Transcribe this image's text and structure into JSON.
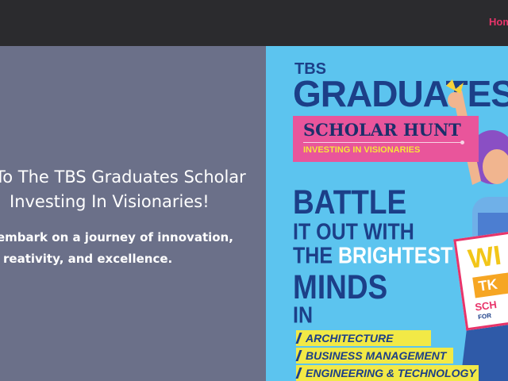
{
  "nav": {
    "home_label": "Home"
  },
  "hero": {
    "title_line1": "To The TBS Graduates Scholar",
    "title_line2": "Investing In Visionaries!",
    "desc_line1": "embark on a journey of innovation,",
    "desc_line2": "reativity, and excellence."
  },
  "poster": {
    "tbs": "TBS",
    "graduates": "GRADUATES",
    "scholar_hunt": "SCHOLAR HUNT",
    "investing": "INVESTING IN VISIONARIES",
    "battle_line1": "BATTLE",
    "battle_line2": "IT OUT WITH",
    "battle_line3_a": "THE",
    "battle_line3_b": "BRIGHTEST",
    "battle_line4": "MINDS",
    "battle_line5": "IN",
    "fields": [
      "ARCHITECTURE",
      "BUSINESS MANAGEMENT",
      "ENGINEERING & TECHNOLOGY"
    ],
    "card": {
      "win": "WI",
      "tk": "TK",
      "sch": "SCH",
      "for": "FOR"
    }
  },
  "colors": {
    "topbar": "#2b2b2e",
    "hero_bg": "#6b7089",
    "accent": "#e8346a",
    "poster_bg": "#5cc4ef",
    "poster_navy": "#1c3f88",
    "poster_pink": "#e9559b",
    "poster_yellow": "#f2e946"
  }
}
